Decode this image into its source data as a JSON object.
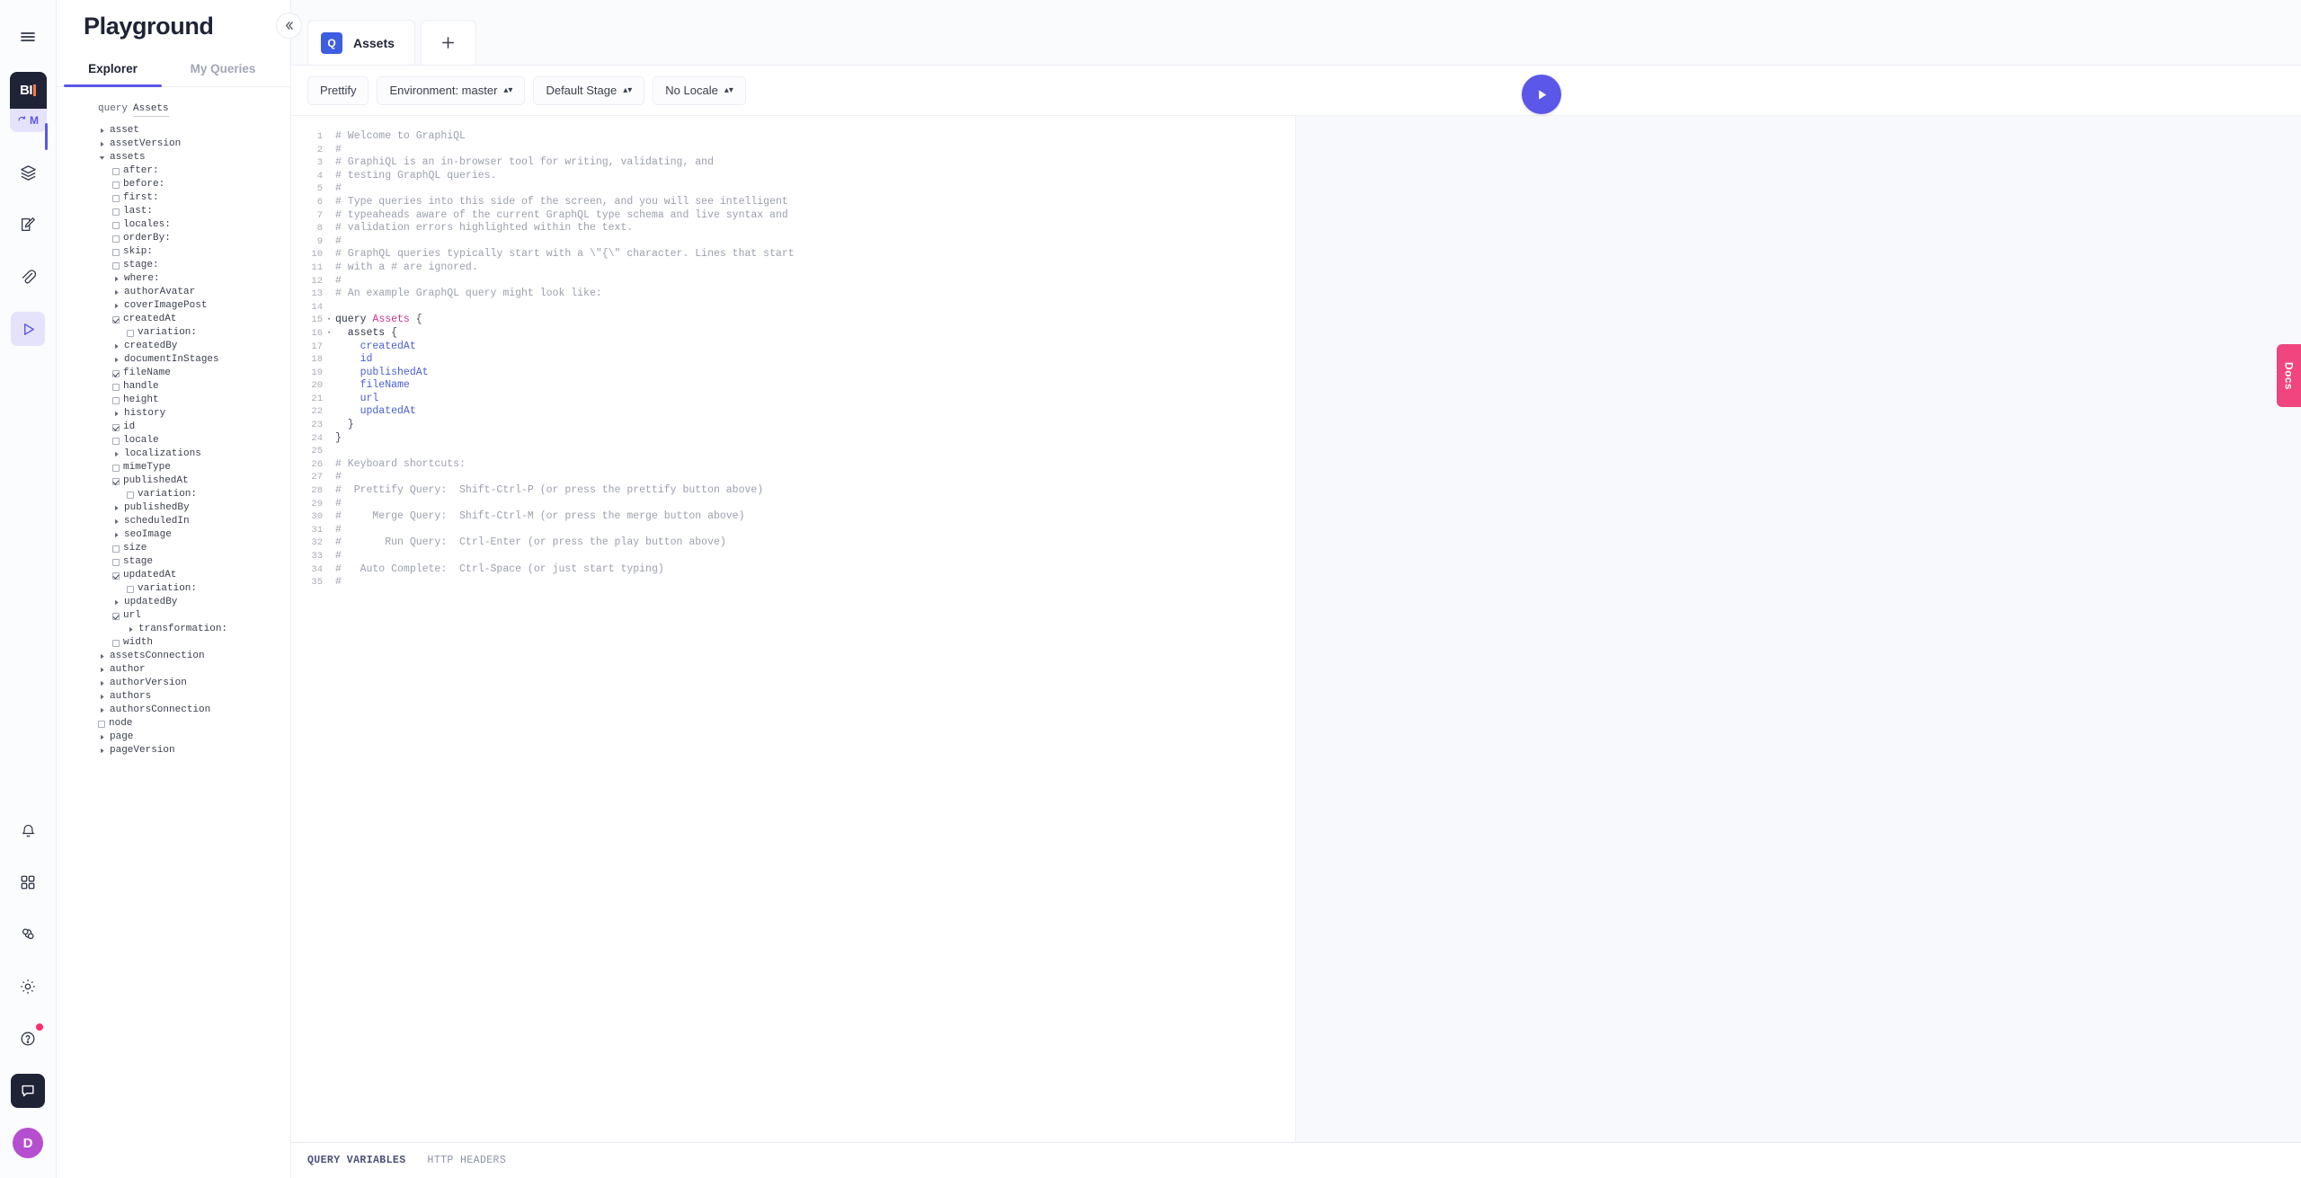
{
  "rail": {
    "menu_icon": "hamburger-icon",
    "logo_text": "BI",
    "logo_sub_text": "M",
    "items": [
      {
        "name": "schema-icon",
        "label": "Schema"
      },
      {
        "name": "content-icon",
        "label": "Content"
      },
      {
        "name": "assets-icon",
        "label": "Assets"
      },
      {
        "name": "api-playground-icon",
        "label": "API Playground"
      }
    ],
    "bottom_items": [
      {
        "name": "notifications-icon",
        "label": "Notifications"
      },
      {
        "name": "apps-icon",
        "label": "Apps"
      },
      {
        "name": "webhooks-icon",
        "label": "Webhooks"
      },
      {
        "name": "settings-icon",
        "label": "Settings"
      },
      {
        "name": "help-icon",
        "label": "Help"
      },
      {
        "name": "chat-icon",
        "label": "Chat"
      }
    ],
    "avatar_initial": "D"
  },
  "explorer": {
    "title": "Playground",
    "tabs": [
      {
        "label": "Explorer",
        "selected": true
      },
      {
        "label": "My Queries",
        "selected": false
      }
    ],
    "tree_head": {
      "keyword": "query",
      "name": "Assets"
    },
    "tree": [
      {
        "label": "asset",
        "indent": 0,
        "type": "caret",
        "open": false
      },
      {
        "label": "assetVersion",
        "indent": 0,
        "type": "caret",
        "open": false
      },
      {
        "label": "assets",
        "indent": 0,
        "type": "caret",
        "open": true
      },
      {
        "label": "after:",
        "indent": 1,
        "type": "check",
        "checked": false
      },
      {
        "label": "before:",
        "indent": 1,
        "type": "check",
        "checked": false
      },
      {
        "label": "first:",
        "indent": 1,
        "type": "check",
        "checked": false
      },
      {
        "label": "last:",
        "indent": 1,
        "type": "check",
        "checked": false
      },
      {
        "label": "locales:",
        "indent": 1,
        "type": "check",
        "checked": false
      },
      {
        "label": "orderBy:",
        "indent": 1,
        "type": "check",
        "checked": false
      },
      {
        "label": "skip:",
        "indent": 1,
        "type": "check",
        "checked": false
      },
      {
        "label": "stage:",
        "indent": 1,
        "type": "check",
        "checked": false
      },
      {
        "label": "where:",
        "indent": 1,
        "type": "caret",
        "open": false
      },
      {
        "label": "authorAvatar",
        "indent": 1,
        "type": "caret",
        "open": false
      },
      {
        "label": "coverImagePost",
        "indent": 1,
        "type": "caret",
        "open": false
      },
      {
        "label": "createdAt",
        "indent": 1,
        "type": "check",
        "checked": true
      },
      {
        "label": "variation:",
        "indent": 2,
        "type": "check",
        "checked": false
      },
      {
        "label": "createdBy",
        "indent": 1,
        "type": "caret",
        "open": false
      },
      {
        "label": "documentInStages",
        "indent": 1,
        "type": "caret",
        "open": false
      },
      {
        "label": "fileName",
        "indent": 1,
        "type": "check",
        "checked": true
      },
      {
        "label": "handle",
        "indent": 1,
        "type": "check",
        "checked": false
      },
      {
        "label": "height",
        "indent": 1,
        "type": "check",
        "checked": false
      },
      {
        "label": "history",
        "indent": 1,
        "type": "caret",
        "open": false
      },
      {
        "label": "id",
        "indent": 1,
        "type": "check",
        "checked": true
      },
      {
        "label": "locale",
        "indent": 1,
        "type": "check",
        "checked": false
      },
      {
        "label": "localizations",
        "indent": 1,
        "type": "caret",
        "open": false
      },
      {
        "label": "mimeType",
        "indent": 1,
        "type": "check",
        "checked": false
      },
      {
        "label": "publishedAt",
        "indent": 1,
        "type": "check",
        "checked": true
      },
      {
        "label": "variation:",
        "indent": 2,
        "type": "check",
        "checked": false
      },
      {
        "label": "publishedBy",
        "indent": 1,
        "type": "caret",
        "open": false
      },
      {
        "label": "scheduledIn",
        "indent": 1,
        "type": "caret",
        "open": false
      },
      {
        "label": "seoImage",
        "indent": 1,
        "type": "caret",
        "open": false
      },
      {
        "label": "size",
        "indent": 1,
        "type": "check",
        "checked": false
      },
      {
        "label": "stage",
        "indent": 1,
        "type": "check",
        "checked": false
      },
      {
        "label": "updatedAt",
        "indent": 1,
        "type": "check",
        "checked": true
      },
      {
        "label": "variation:",
        "indent": 2,
        "type": "check",
        "checked": false
      },
      {
        "label": "updatedBy",
        "indent": 1,
        "type": "caret",
        "open": false
      },
      {
        "label": "url",
        "indent": 1,
        "type": "check",
        "checked": true
      },
      {
        "label": "transformation:",
        "indent": 2,
        "type": "caret",
        "open": false
      },
      {
        "label": "width",
        "indent": 1,
        "type": "check",
        "checked": false
      },
      {
        "label": "assetsConnection",
        "indent": 0,
        "type": "caret",
        "open": false
      },
      {
        "label": "author",
        "indent": 0,
        "type": "caret",
        "open": false
      },
      {
        "label": "authorVersion",
        "indent": 0,
        "type": "caret",
        "open": false
      },
      {
        "label": "authors",
        "indent": 0,
        "type": "caret",
        "open": false
      },
      {
        "label": "authorsConnection",
        "indent": 0,
        "type": "caret",
        "open": false
      },
      {
        "label": "node",
        "indent": 0,
        "type": "check",
        "checked": false
      },
      {
        "label": "page",
        "indent": 0,
        "type": "caret",
        "open": false
      },
      {
        "label": "pageVersion",
        "indent": 0,
        "type": "caret",
        "open": false
      }
    ]
  },
  "main": {
    "query_tab": {
      "badge": "Q",
      "label": "Assets"
    },
    "add_tab_label": "+",
    "collapse_icon": "chevron-double-left-icon",
    "toolbar": [
      {
        "label": "Prettify",
        "dropdown": false
      },
      {
        "label": "Environment: master",
        "dropdown": true
      },
      {
        "label": "Default Stage",
        "dropdown": true
      },
      {
        "label": "No Locale",
        "dropdown": true
      }
    ],
    "run_button_label": "play-icon",
    "bottom_tabs": [
      {
        "label": "QUERY VARIABLES",
        "active": true
      },
      {
        "label": "HTTP HEADERS",
        "active": false
      }
    ],
    "docs_label": "Docs"
  },
  "code": {
    "lines": [
      {
        "n": 1,
        "fold": "",
        "tokens": [
          {
            "t": "# Welcome to GraphiQL",
            "c": "c-com"
          }
        ]
      },
      {
        "n": 2,
        "fold": "",
        "tokens": [
          {
            "t": "#",
            "c": "c-com"
          }
        ]
      },
      {
        "n": 3,
        "fold": "",
        "tokens": [
          {
            "t": "# GraphiQL is an in-browser tool for writing, validating, and",
            "c": "c-com"
          }
        ]
      },
      {
        "n": 4,
        "fold": "",
        "tokens": [
          {
            "t": "# testing GraphQL queries.",
            "c": "c-com"
          }
        ]
      },
      {
        "n": 5,
        "fold": "",
        "tokens": [
          {
            "t": "#",
            "c": "c-com"
          }
        ]
      },
      {
        "n": 6,
        "fold": "",
        "tokens": [
          {
            "t": "# Type queries into this side of the screen, and you will see intelligent",
            "c": "c-com"
          }
        ]
      },
      {
        "n": 7,
        "fold": "",
        "tokens": [
          {
            "t": "# typeaheads aware of the current GraphQL type schema and live syntax and",
            "c": "c-com"
          }
        ]
      },
      {
        "n": 8,
        "fold": "",
        "tokens": [
          {
            "t": "# validation errors highlighted within the text.",
            "c": "c-com"
          }
        ]
      },
      {
        "n": 9,
        "fold": "",
        "tokens": [
          {
            "t": "#",
            "c": "c-com"
          }
        ]
      },
      {
        "n": 10,
        "fold": "",
        "tokens": [
          {
            "t": "# GraphQL queries typically start with a \\\"{\\\" character. Lines that start",
            "c": "c-com"
          }
        ]
      },
      {
        "n": 11,
        "fold": "",
        "tokens": [
          {
            "t": "# with a # are ignored.",
            "c": "c-com"
          }
        ]
      },
      {
        "n": 12,
        "fold": "",
        "tokens": [
          {
            "t": "#",
            "c": "c-com"
          }
        ]
      },
      {
        "n": 13,
        "fold": "",
        "tokens": [
          {
            "t": "# An example GraphQL query might look like:",
            "c": "c-com"
          }
        ]
      },
      {
        "n": 14,
        "fold": "",
        "tokens": []
      },
      {
        "n": 15,
        "fold": "▾",
        "tokens": [
          {
            "t": "query ",
            "c": "c-kw"
          },
          {
            "t": "Assets",
            "c": "c-op"
          },
          {
            "t": " {",
            "c": "c-br"
          }
        ]
      },
      {
        "n": 16,
        "fold": "▾",
        "tokens": [
          {
            "t": "  assets",
            "c": "c-kw"
          },
          {
            "t": " {",
            "c": "c-br"
          }
        ]
      },
      {
        "n": 17,
        "fold": "",
        "tokens": [
          {
            "t": "    createdAt",
            "c": "c-fld"
          }
        ]
      },
      {
        "n": 18,
        "fold": "",
        "tokens": [
          {
            "t": "    id",
            "c": "c-fld"
          }
        ]
      },
      {
        "n": 19,
        "fold": "",
        "tokens": [
          {
            "t": "    publishedAt",
            "c": "c-fld"
          }
        ]
      },
      {
        "n": 20,
        "fold": "",
        "tokens": [
          {
            "t": "    fileName",
            "c": "c-fld"
          }
        ]
      },
      {
        "n": 21,
        "fold": "",
        "tokens": [
          {
            "t": "    url",
            "c": "c-fld"
          }
        ]
      },
      {
        "n": 22,
        "fold": "",
        "tokens": [
          {
            "t": "    updatedAt",
            "c": "c-fld"
          }
        ]
      },
      {
        "n": 23,
        "fold": "",
        "tokens": [
          {
            "t": "  }",
            "c": "c-br"
          }
        ]
      },
      {
        "n": 24,
        "fold": "",
        "tokens": [
          {
            "t": "}",
            "c": "c-br"
          }
        ]
      },
      {
        "n": 25,
        "fold": "",
        "tokens": []
      },
      {
        "n": 26,
        "fold": "",
        "tokens": [
          {
            "t": "# Keyboard shortcuts:",
            "c": "c-com"
          }
        ]
      },
      {
        "n": 27,
        "fold": "",
        "tokens": [
          {
            "t": "#",
            "c": "c-com"
          }
        ]
      },
      {
        "n": 28,
        "fold": "",
        "tokens": [
          {
            "t": "#  Prettify Query:  Shift-Ctrl-P (or press the prettify button above)",
            "c": "c-com"
          }
        ]
      },
      {
        "n": 29,
        "fold": "",
        "tokens": [
          {
            "t": "#",
            "c": "c-com"
          }
        ]
      },
      {
        "n": 30,
        "fold": "",
        "tokens": [
          {
            "t": "#     Merge Query:  Shift-Ctrl-M (or press the merge button above)",
            "c": "c-com"
          }
        ]
      },
      {
        "n": 31,
        "fold": "",
        "tokens": [
          {
            "t": "#",
            "c": "c-com"
          }
        ]
      },
      {
        "n": 32,
        "fold": "",
        "tokens": [
          {
            "t": "#       Run Query:  Ctrl-Enter (or press the play button above)",
            "c": "c-com"
          }
        ]
      },
      {
        "n": 33,
        "fold": "",
        "tokens": [
          {
            "t": "#",
            "c": "c-com"
          }
        ]
      },
      {
        "n": 34,
        "fold": "",
        "tokens": [
          {
            "t": "#   Auto Complete:  Ctrl-Space (or just start typing)",
            "c": "c-com"
          }
        ]
      },
      {
        "n": 35,
        "fold": "",
        "tokens": [
          {
            "t": "#",
            "c": "c-com"
          }
        ]
      }
    ]
  },
  "colors": {
    "accent": "#5b57e8",
    "badge": "#3c5ee0",
    "docs": "#f0457f",
    "avatar": "#b54fd0",
    "dark": "#1f2336"
  }
}
